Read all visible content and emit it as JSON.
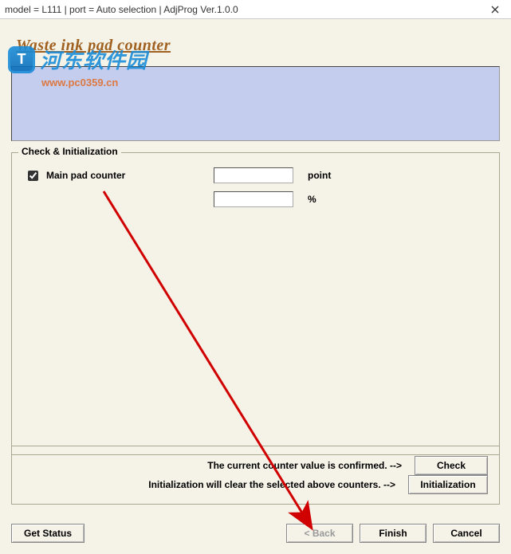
{
  "title": "model = L111 | port = Auto selection | AdjProg Ver.1.0.0",
  "heading": "Waste ink pad counter",
  "watermark": {
    "chinese": "河东软件园",
    "url": "www.pc0359.cn"
  },
  "group": {
    "legend": "Check & Initialization",
    "rows": [
      {
        "checked": true,
        "label": "Main pad counter",
        "value": "",
        "unit": "point"
      },
      {
        "checked": null,
        "label": "",
        "value": "",
        "unit": "%"
      }
    ]
  },
  "messages": {
    "check": "The current counter value is confirmed. -->",
    "init": "Initialization will clear the selected above counters. -->"
  },
  "buttons": {
    "check": "Check",
    "initialization": "Initialization",
    "get_status": "Get Status",
    "back": "< Back",
    "finish": "Finish",
    "cancel": "Cancel"
  }
}
